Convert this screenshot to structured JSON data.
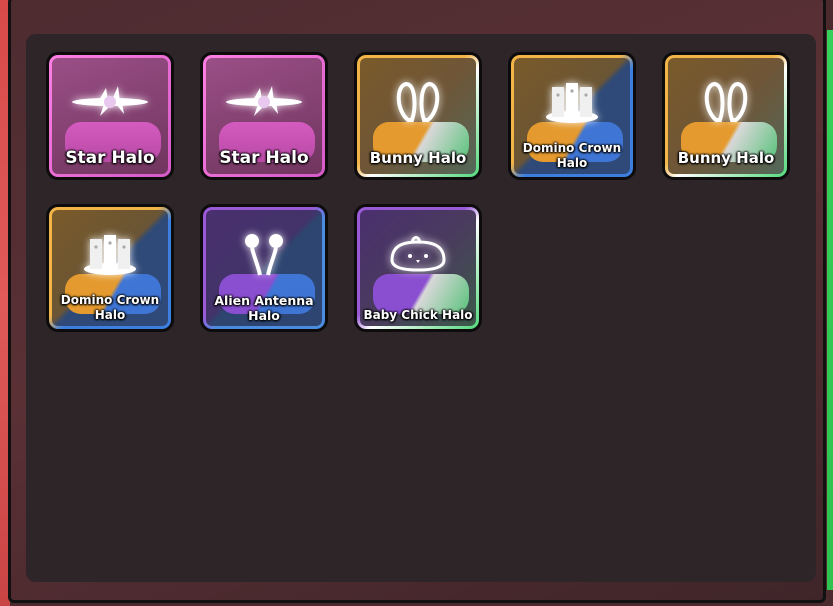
{
  "inventory": {
    "items": [
      {
        "name": "Star Halo",
        "icon": "star-halo-icon",
        "theme": "pink"
      },
      {
        "name": "Star Halo",
        "icon": "star-halo-icon",
        "theme": "pink"
      },
      {
        "name": "Bunny Halo",
        "icon": "bunny-halo-icon",
        "theme": "gold-green"
      },
      {
        "name": "Domino Crown Halo",
        "icon": "domino-crown-halo-icon",
        "theme": "gold-blue"
      },
      {
        "name": "Bunny Halo",
        "icon": "bunny-halo-icon",
        "theme": "gold-green"
      },
      {
        "name": "Domino Crown Halo",
        "icon": "domino-crown-halo-icon",
        "theme": "gold-blue"
      },
      {
        "name": "Alien Antenna Halo",
        "icon": "alien-antenna-halo-icon",
        "theme": "purple-blue"
      },
      {
        "name": "Baby Chick Halo",
        "icon": "baby-chick-halo-icon",
        "theme": "purple-green"
      }
    ]
  },
  "colors": {
    "panel": "#2d2527",
    "pink": "#e46fd5",
    "gold": "#f0a83a",
    "blue": "#4a8ce0",
    "green": "#4fd67a",
    "purple": "#9a5ad8"
  }
}
